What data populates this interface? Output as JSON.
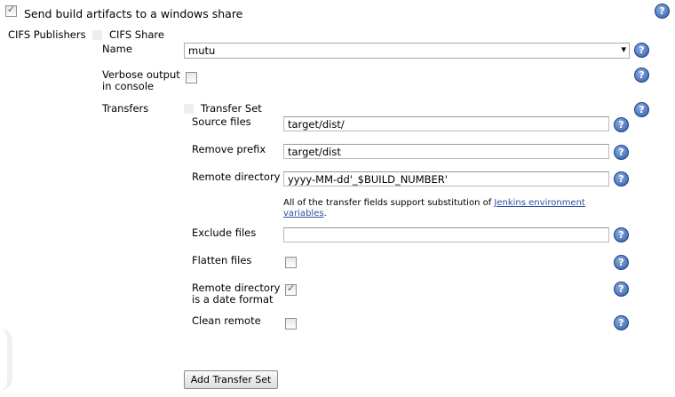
{
  "header": {
    "enable_label": "Send build artifacts to a windows share",
    "enabled": true
  },
  "publishers": {
    "label": "CIFS Publishers",
    "share_title": "CIFS Share"
  },
  "name": {
    "label": "Name",
    "value": "mutu"
  },
  "verbose": {
    "label_line1": "Verbose output",
    "label_line2": "in console",
    "checked": false
  },
  "transfers": {
    "label": "Transfers",
    "set_title": "Transfer Set"
  },
  "source_files": {
    "label": "Source files",
    "value": "target/dist/"
  },
  "remove_prefix": {
    "label": "Remove prefix",
    "value": "target/dist"
  },
  "remote_directory": {
    "label": "Remote directory",
    "value": "yyyy-MM-dd'_$BUILD_NUMBER'"
  },
  "note": {
    "text": "All of the transfer fields support substitution of ",
    "link": "Jenkins environment variables",
    "end": "."
  },
  "exclude_files": {
    "label": "Exclude files",
    "value": ""
  },
  "flatten": {
    "label": "Flatten files",
    "checked": false
  },
  "date_format": {
    "label_line1": "Remote directory",
    "label_line2": "is a date format",
    "checked": true
  },
  "clean_remote": {
    "label": "Clean remote",
    "checked": false
  },
  "add_button": "Add Transfer Set",
  "help_glyph": "?"
}
